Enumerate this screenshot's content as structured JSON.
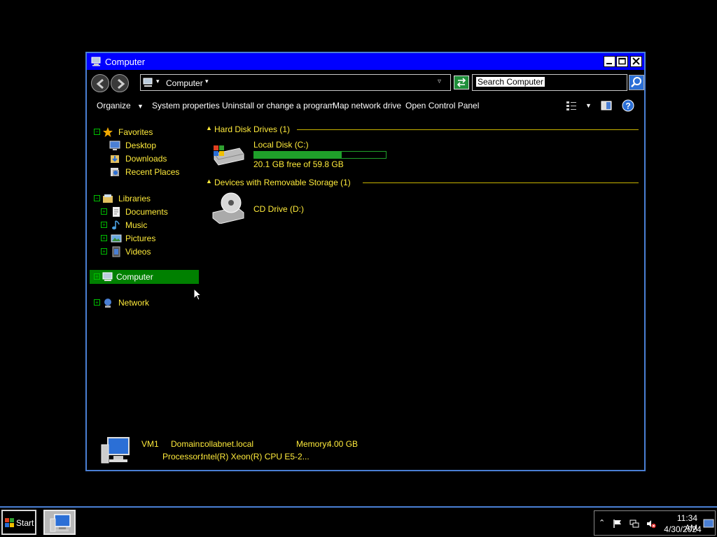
{
  "window": {
    "title": "Computer",
    "title_icon": "computer-icon"
  },
  "address": {
    "crumb": "Computer",
    "search_placeholder": "Search Computer"
  },
  "toolbar": {
    "organize": "Organize",
    "system_properties": "System properties",
    "uninstall": "Uninstall or change a program",
    "map_drive": "Map network drive",
    "control_panel": "Open Control Panel"
  },
  "nav": {
    "favorites": {
      "label": "Favorites",
      "items": [
        "Desktop",
        "Downloads",
        "Recent Places"
      ]
    },
    "libraries": {
      "label": "Libraries",
      "items": [
        "Documents",
        "Music",
        "Pictures",
        "Videos"
      ]
    },
    "computer": "Computer",
    "network": "Network"
  },
  "content": {
    "groups": [
      {
        "title": "Hard Disk Drives (1)",
        "items": [
          {
            "name": "Local Disk (C:)",
            "free_text": "20.1 GB free of 59.8 GB",
            "used_fraction": 0.664,
            "icon": "hard-disk-icon"
          }
        ]
      },
      {
        "title": "Devices with Removable Storage (1)",
        "items": [
          {
            "name": "CD Drive (D:)",
            "icon": "cd-drive-icon"
          }
        ]
      }
    ]
  },
  "details": {
    "computer_name": "VM1",
    "domain_label": "Domain:",
    "domain_value": "collabnet.local",
    "memory_label": "Memory:",
    "memory_value": "4.00 GB",
    "processor_label": "Processor:",
    "processor_value": "Intel(R) Xeon(R) CPU E5-2..."
  },
  "taskbar": {
    "start_label": "Start",
    "time": "11:34 AM",
    "date": "4/30/2024"
  },
  "colors": {
    "title_bar": "#0000ff",
    "text_accent": "#ffeb3b",
    "selection": "#008000",
    "disk_bar": "#1fa02a"
  }
}
